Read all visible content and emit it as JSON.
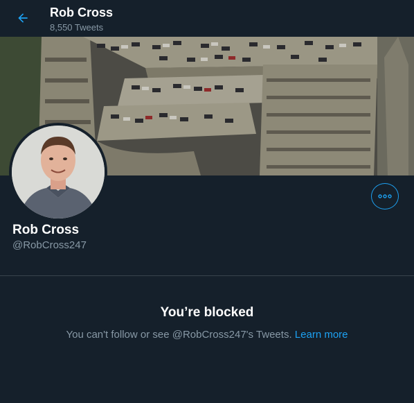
{
  "header": {
    "name": "Rob Cross",
    "tweet_count": "8,550 Tweets",
    "back_icon": "arrow-left-icon"
  },
  "profile": {
    "name": "Rob Cross",
    "handle": "@RobCross247",
    "more_icon": "ellipsis-icon"
  },
  "blocked": {
    "title": "You’re blocked",
    "message": "You can't follow or see @RobCross247's Tweets.",
    "learn_more": "Learn more"
  },
  "colors": {
    "background": "#15202b",
    "accent": "#1da1f2",
    "secondary_text": "#8899a6",
    "divider": "#38444d"
  }
}
